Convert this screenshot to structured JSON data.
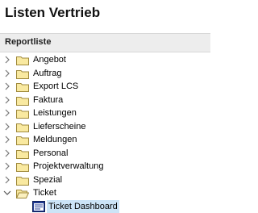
{
  "header": {
    "title": "Listen Vertrieb"
  },
  "section": {
    "label": "Reportliste"
  },
  "tree": {
    "items": [
      {
        "label": "Angebot",
        "expanded": false
      },
      {
        "label": "Auftrag",
        "expanded": false
      },
      {
        "label": "Export LCS",
        "expanded": false
      },
      {
        "label": "Faktura",
        "expanded": false
      },
      {
        "label": "Leistungen",
        "expanded": false
      },
      {
        "label": "Lieferscheine",
        "expanded": false
      },
      {
        "label": "Meldungen",
        "expanded": false
      },
      {
        "label": "Personal",
        "expanded": false
      },
      {
        "label": "Projektverwaltung",
        "expanded": false
      },
      {
        "label": "Spezial",
        "expanded": false
      },
      {
        "label": "Ticket",
        "expanded": true
      }
    ],
    "child": {
      "label": "Ticket Dashboard",
      "selected": true
    }
  },
  "colors": {
    "folder_fill": "#f9e9a0",
    "folder_stroke": "#a08a3c",
    "selection": "#cce4f7",
    "header_bg": "#ededed"
  }
}
